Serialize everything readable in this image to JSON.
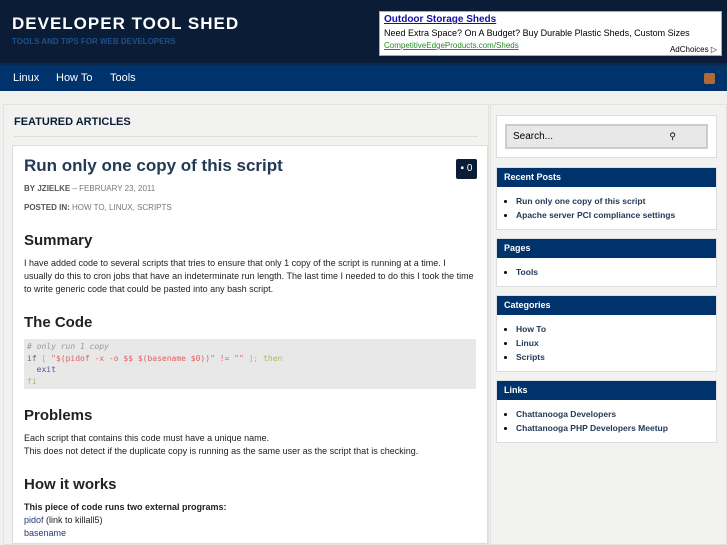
{
  "header": {
    "title": "DEVELOPER TOOL SHED",
    "tagline": "TOOLS AND TIPS FOR WEB DEVELOPERS"
  },
  "ad": {
    "title": "Outdoor Storage Sheds",
    "desc": "Need Extra Space? On A Budget? Buy Durable Plastic Sheds, Custom Sizes",
    "url": "CompetitiveEdgeProducts.com/Sheds",
    "choices": "AdChoices ▷"
  },
  "nav": [
    "Linux",
    "How To",
    "Tools"
  ],
  "main": {
    "section": "FEATURED ARTICLES",
    "title": "Run only one copy of this script",
    "by": "BY",
    "author": "JZIELKE",
    "date": "– FEBRUARY 23, 2011",
    "posted_label": "POSTED IN:",
    "posted": "HOW TO, LINUX, SCRIPTS",
    "comments": "0",
    "h_summary": "Summary",
    "summary": "I have added code to several scripts that tries to ensure that only 1 copy of the script is running at a time.  I usually do this to cron jobs that have an indeterminate run length.  The last time I needed to do this I took the time to write generic code that could be pasted into any bash script.",
    "h_code": "The Code",
    "code": {
      "c": "# only run 1 copy",
      "if": "if",
      "b1": "[",
      "str": "\"$(pidof -x -o $$ $(basename $0))\" != \"\"",
      "b2": "];",
      "then": "then",
      "exit": "  exit",
      "fi": "fi"
    },
    "h_problems": "Problems",
    "p1": "Each script that contains this code must have a unique name.",
    "p2": "This does not detect if the duplicate copy is running as the same user as the script that is checking.",
    "h_how": "How it works",
    "how_bold": "This piece of code runs two external programs:",
    "prog1": "pidof",
    "prog1_note": " (link to killall5)",
    "prog2": "basename"
  },
  "sidebar": {
    "search_placeholder": "Search...",
    "recent_title": "Recent Posts",
    "recent": [
      "Run only one copy of this script",
      "Apache server PCI compliance settings"
    ],
    "pages_title": "Pages",
    "pages": [
      "Tools"
    ],
    "categories_title": "Categories",
    "categories": [
      "How To",
      "Linux",
      "Scripts"
    ],
    "links_title": "Links",
    "links": [
      "Chattanooga Developers",
      "Chattanooga PHP Developers Meetup"
    ]
  }
}
